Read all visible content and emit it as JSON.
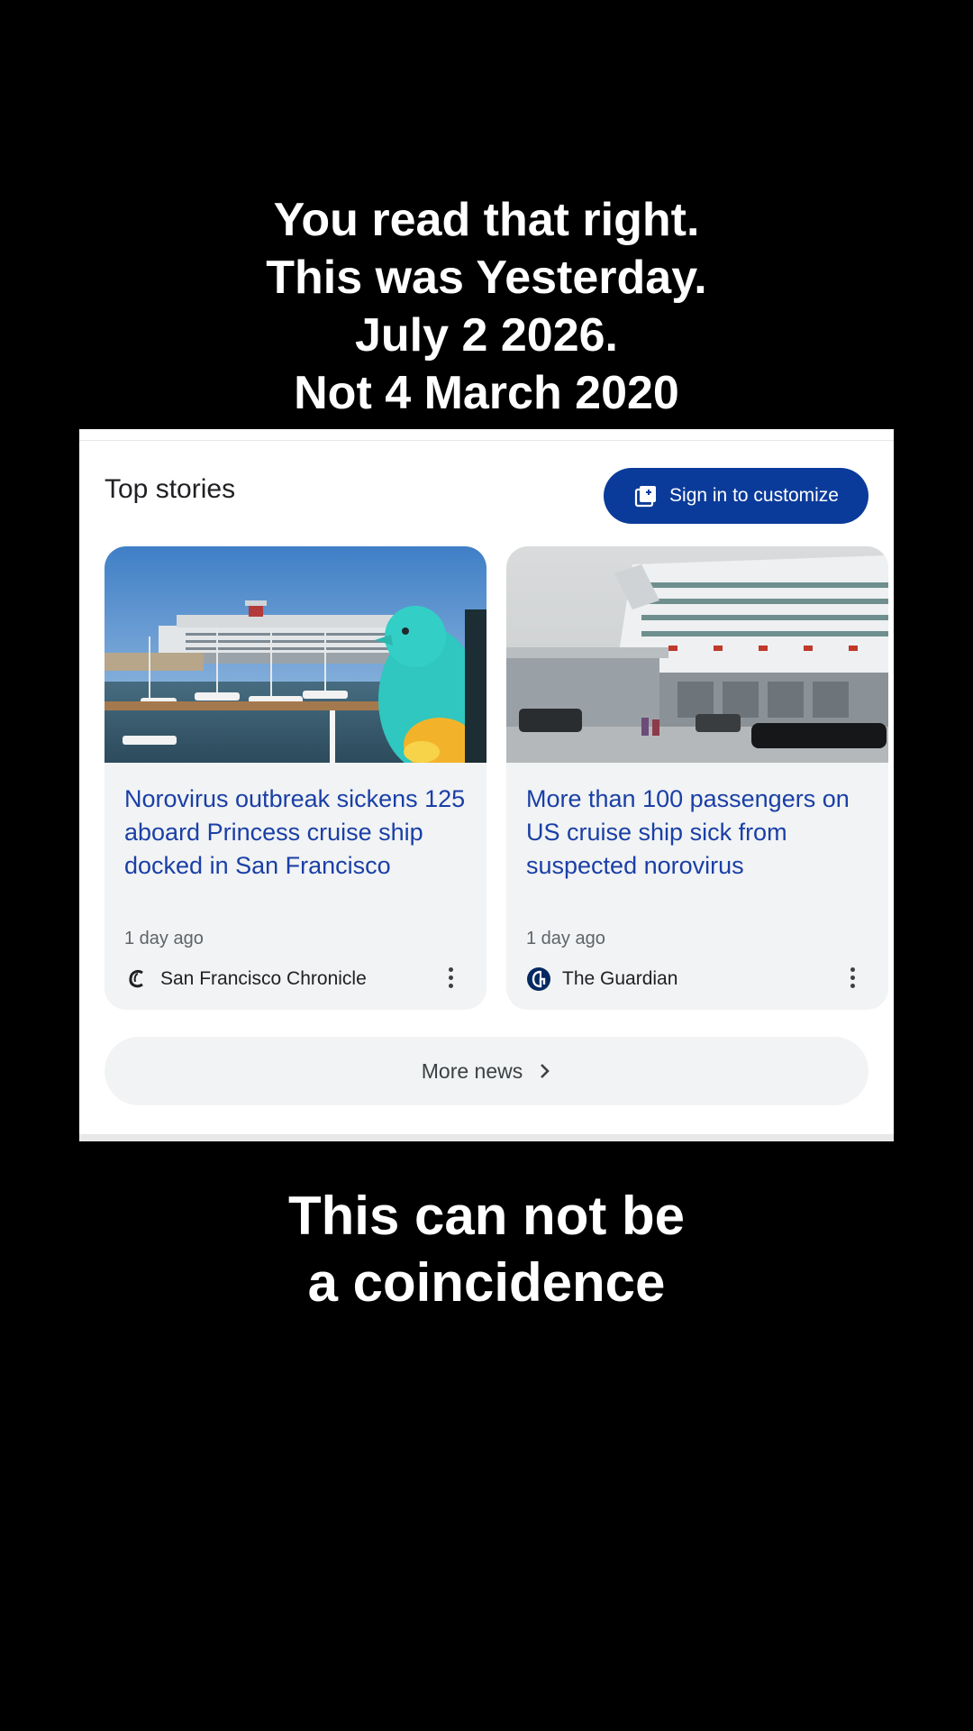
{
  "overlay": {
    "top_lines": [
      "You read that right.",
      "This was Yesterday.",
      "July 2 2026.",
      "Not 4 March 2020"
    ],
    "bottom_lines": [
      "This can not be",
      "a coincidence"
    ]
  },
  "top_stories": {
    "title": "Top stories",
    "signin_label": "Sign in to customize",
    "accent_color": "#0b3b9a",
    "headline_color": "#1a3fa6",
    "cards": [
      {
        "headline": "Norovirus outbreak sickens 125 aboard Princess cruise ship docked in San Francisco",
        "time": "1 day ago",
        "source": "San Francisco Chronicle",
        "source_icon": "chronicle-logo-icon",
        "image": "cruise-ship-harbor-with-penguin-statue"
      },
      {
        "headline": "More than 100 passengers on US cruise ship sick from suspected norovirus",
        "time": "1 day ago",
        "source": "The Guardian",
        "source_icon": "guardian-logo-icon",
        "image": "cruise-ship-at-terminal"
      }
    ],
    "more_news_label": "More news"
  }
}
